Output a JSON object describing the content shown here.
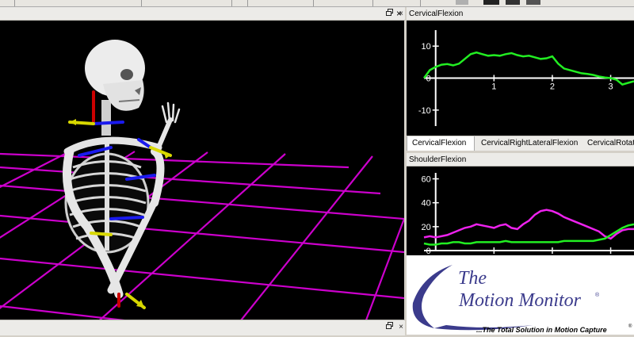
{
  "left_panel": {
    "title": "",
    "restore_icon": "restore-icon",
    "close_label": "×"
  },
  "bottom_panel": {
    "close_label": "×"
  },
  "chart_top": {
    "title": "CervicalFlexion",
    "close_label": "×",
    "y_ticks": [
      "10",
      "0",
      "-10"
    ],
    "x_ticks": [
      "1",
      "2",
      "3"
    ]
  },
  "tabs": [
    {
      "label": "CervicalFlexion",
      "active": true
    },
    {
      "label": "CervicalRightLateralFlexion",
      "active": false
    },
    {
      "label": "CervicalRotatio",
      "active": false
    }
  ],
  "chart_bottom": {
    "title": "ShoulderFlexion",
    "close_label": "×",
    "y_ticks": [
      "60",
      "40",
      "20",
      "0"
    ]
  },
  "logo": {
    "line1": "The",
    "line2": "Motion Monitor",
    "trademark": "®",
    "tagline": "...The Total Solution in Motion Capture",
    "tagline_mark": "®"
  },
  "chart_data": [
    {
      "type": "line",
      "title": "CervicalFlexion",
      "xlim": [
        -0.2,
        3.4
      ],
      "ylim": [
        -15,
        15
      ],
      "series": [
        {
          "color": "#22ee22",
          "x": [
            -0.2,
            -0.1,
            0.0,
            0.1,
            0.2,
            0.3,
            0.4,
            0.5,
            0.6,
            0.7,
            0.8,
            0.9,
            1.0,
            1.1,
            1.2,
            1.3,
            1.4,
            1.5,
            1.6,
            1.7,
            1.8,
            1.9,
            2.0,
            2.1,
            2.2,
            2.3,
            2.4,
            2.5,
            2.6,
            2.7,
            2.8,
            2.9,
            3.0,
            3.1,
            3.2,
            3.3,
            3.4
          ],
          "y": [
            0,
            2.5,
            3.5,
            4.2,
            4.4,
            4.0,
            4.5,
            6.0,
            7.5,
            8.0,
            7.5,
            7.0,
            7.2,
            7.0,
            7.5,
            7.8,
            7.2,
            6.8,
            7.0,
            6.5,
            6.0,
            6.2,
            6.8,
            4.5,
            3.0,
            2.5,
            2.0,
            1.5,
            1.3,
            1.0,
            0.5,
            0.2,
            0.0,
            -0.5,
            -2.0,
            -1.5,
            -1.0
          ]
        }
      ]
    },
    {
      "type": "line",
      "title": "ShoulderFlexion",
      "xlim": [
        -0.2,
        3.4
      ],
      "ylim": [
        0,
        65
      ],
      "series": [
        {
          "color": "#ee22ee",
          "x": [
            -0.2,
            -0.1,
            0.0,
            0.1,
            0.2,
            0.3,
            0.4,
            0.5,
            0.6,
            0.7,
            0.8,
            0.9,
            1.0,
            1.1,
            1.2,
            1.3,
            1.4,
            1.5,
            1.6,
            1.7,
            1.8,
            1.9,
            2.0,
            2.1,
            2.2,
            2.3,
            2.4,
            2.5,
            2.6,
            2.7,
            2.8,
            2.9,
            3.0,
            3.1,
            3.2,
            3.3,
            3.4
          ],
          "y": [
            11,
            12,
            11,
            12,
            13,
            15,
            17,
            19,
            20,
            22,
            21,
            20,
            19,
            21,
            22,
            19,
            18,
            22,
            25,
            30,
            33,
            34,
            33,
            31,
            28,
            26,
            24,
            22,
            20,
            18,
            16,
            12,
            10,
            14,
            17,
            18,
            18
          ]
        },
        {
          "color": "#22ee22",
          "x": [
            -0.2,
            -0.1,
            0.0,
            0.1,
            0.2,
            0.3,
            0.4,
            0.5,
            0.6,
            0.7,
            0.8,
            0.9,
            1.0,
            1.1,
            1.2,
            1.3,
            1.4,
            1.5,
            1.6,
            1.7,
            1.8,
            1.9,
            2.0,
            2.1,
            2.2,
            2.3,
            2.4,
            2.5,
            2.6,
            2.7,
            2.8,
            2.9,
            3.0,
            3.1,
            3.2,
            3.3,
            3.4
          ],
          "y": [
            6,
            5,
            5,
            6,
            6,
            7,
            7,
            6,
            6,
            7,
            7,
            7,
            7,
            7,
            8,
            7,
            7,
            7,
            7,
            7,
            7,
            7,
            7,
            7,
            8,
            8,
            8,
            8,
            8,
            8,
            9,
            10,
            13,
            16,
            19,
            21,
            22
          ]
        }
      ]
    }
  ]
}
